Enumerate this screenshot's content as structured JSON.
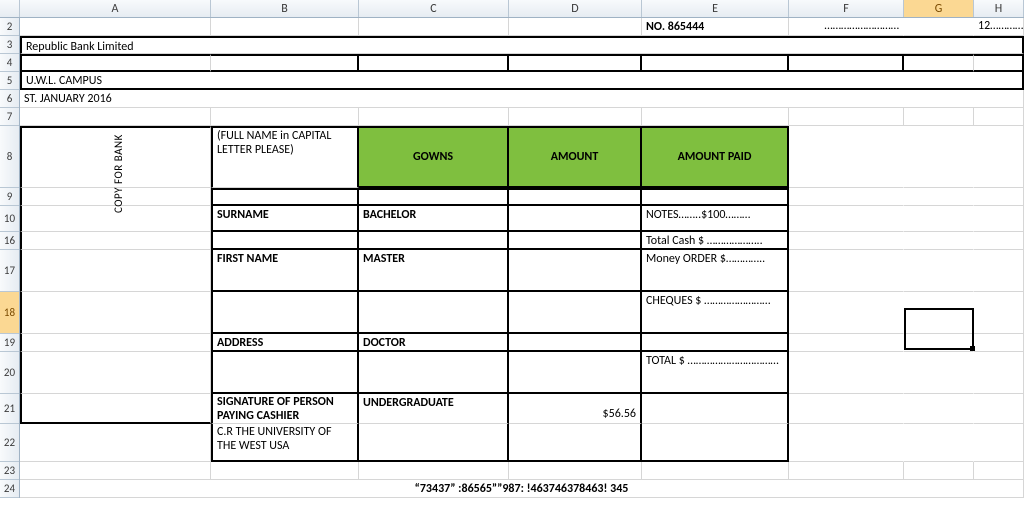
{
  "columns": [
    "A",
    "B",
    "C",
    "D",
    "E",
    "F",
    "G",
    "H"
  ],
  "rows_visible": [
    "2",
    "3",
    "4",
    "5",
    "6",
    "7",
    "8",
    "9",
    "10",
    "16",
    "17",
    "18",
    "19",
    "20",
    "21",
    "22",
    "23",
    "24"
  ],
  "selected_col": "G",
  "selected_row": "18",
  "header_right": {
    "no_label": "NO.  865444",
    "year_suffix": "12"
  },
  "bank_line": "Republic Bank Limited",
  "campus_line": "U.W.L. CAMPUS",
  "date_line": "ST. JANUARY 2016",
  "vertical_label": "COPY FOR BANK",
  "form": {
    "name_label": "(FULL NAME in CAPITAL LETTER PLEASE)",
    "col_gowns": "GOWNS",
    "col_amount": "AMOUNT",
    "col_amount_paid": "AMOUNT PAID",
    "surname_label": "SURNAME",
    "bachelor": "BACHELOR",
    "notes_line": "NOTES……..$100………",
    "total_cash": "Total Cash  $ ………………..",
    "firstname_label": "FIRST NAME",
    "master": "MASTER",
    "money_order": "Money ORDER $…………..",
    "cheques": "CHEQUES  $ ……………………",
    "address_label": "ADDRESS",
    "doctor": "DOCTOR",
    "total": "TOTAL $ ……………………………",
    "signature": "SIGNATURE OF PERSON PAYING CASHIER",
    "undergrad": "UNDERGRADUATE",
    "amount_value": "$56.56",
    "cr_line": "C.R THE UNIVERSITY OF THE WEST USA"
  },
  "footer_code": "“73437” :86565””987: !463746378463! 345",
  "dots": "………………………",
  "dots_short": "……………"
}
